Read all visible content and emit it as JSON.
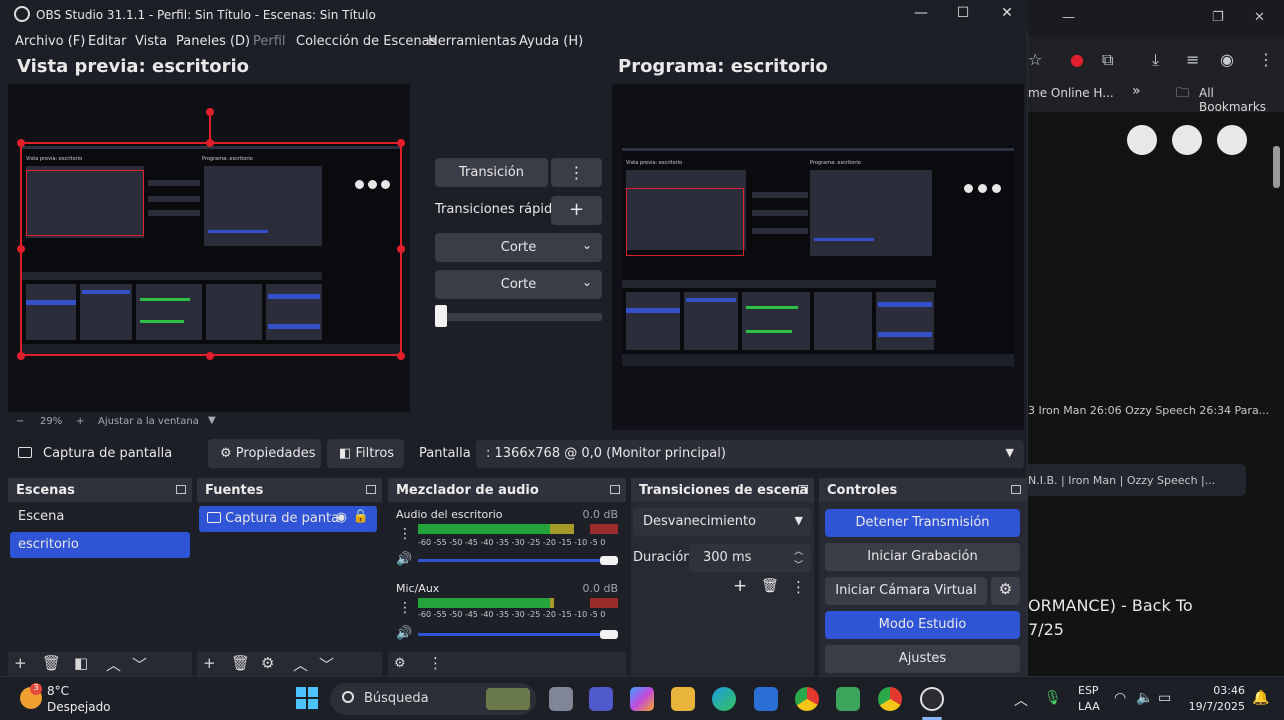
{
  "window": {
    "title": "OBS Studio 31.1.1 - Perfil: Sin Título - Escenas: Sin Título",
    "minimize": "—",
    "maximize": "☐",
    "close": "✕"
  },
  "menu": [
    "Archivo (F)",
    "Editar",
    "Vista",
    "Paneles (D)",
    "Perfil",
    "Colección de Escenas",
    "Herramientas",
    "Ayuda (H)"
  ],
  "preview": {
    "title": "Vista previa: escritorio",
    "zoom": "29%",
    "zoom_minus": "−",
    "zoom_plus": "+",
    "fit_label": "Ajustar a la ventana",
    "mini_preview_label": "Vista previa: escritorio",
    "mini_program_label": "Programa: escritorio"
  },
  "program": {
    "title": "Programa: escritorio"
  },
  "transition_panel": {
    "transition_button": "Transición",
    "quick_label": "Transiciones rápidas",
    "cut1": "Corte",
    "cut2": "Corte"
  },
  "source_toolbar": {
    "source_name": "Captura de pantalla",
    "properties": "Propiedades",
    "filters": "Filtros",
    "screen_label": "Pantalla",
    "screen_value": ": 1366x768 @ 0,0 (Monitor principal)"
  },
  "scenes": {
    "title": "Escenas",
    "items": [
      {
        "label": "Escena",
        "selected": false
      },
      {
        "label": "escritorio",
        "selected": true
      }
    ]
  },
  "sources": {
    "title": "Fuentes",
    "items": [
      {
        "label": "Captura de panta"
      }
    ]
  },
  "mixer": {
    "title": "Mezclador de audio",
    "channels": [
      {
        "name": "Audio del escritorio",
        "db": "0.0 dB",
        "level": 0.78
      },
      {
        "name": "Mic/Aux",
        "db": "0.0 dB",
        "level": 0.68
      }
    ],
    "scale": "-60 -55 -50 -45 -40 -35 -30 -25 -20 -15 -10  -5   0"
  },
  "scene_transitions": {
    "title": "Transiciones de escena",
    "selected": "Desvanecimiento",
    "duration_label": "Duración",
    "duration_value": "300 ms"
  },
  "controls": {
    "title": "Controles",
    "stop_stream": "Detener Transmisión",
    "start_recording": "Iniciar Grabación",
    "virtual_cam": "Iniciar Cámara Virtual",
    "studio_mode": "Modo Estudio",
    "settings": "Ajustes"
  },
  "browser": {
    "bookmark_tab": "me Online H...",
    "more": "»",
    "all_bookmarks": "All Bookmarks",
    "yt_line1": "3 Iron Man 26:06 Ozzy Speech 26:34 Para...",
    "yt_chip": "N.I.B. | Iron Man | Ozzy Speech |...",
    "yt_title1": "ORMANCE) - Back To",
    "yt_title2": "7/25"
  },
  "taskbar": {
    "temp": "8°C",
    "weather": "Despejado",
    "weather_badge": "3",
    "search_placeholder": "Búsqueda",
    "lang1": "ESP",
    "lang2": "LAA",
    "time": "03:46",
    "date": "19/7/2025"
  }
}
